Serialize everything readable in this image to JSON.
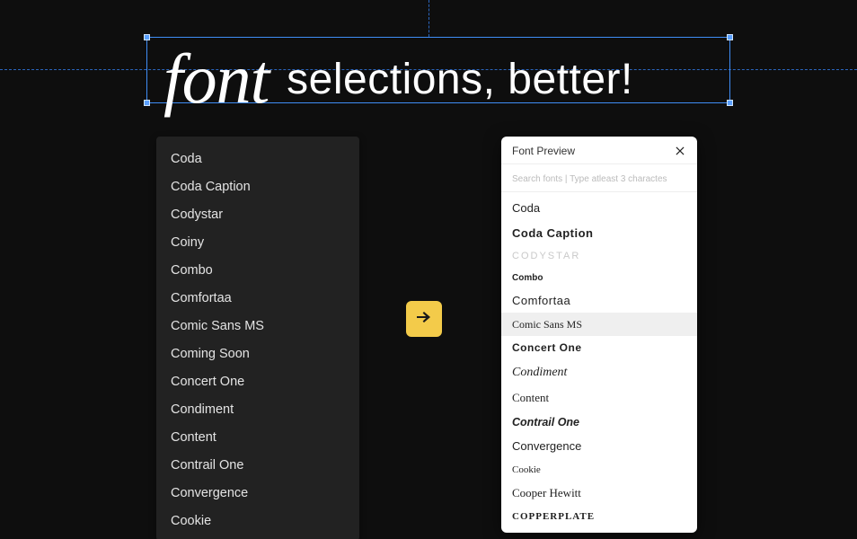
{
  "heading": {
    "script_word": "font",
    "rest": " selections, better!"
  },
  "dark_list": {
    "items": [
      "Coda",
      "Coda Caption",
      "Codystar",
      "Coiny",
      "Combo",
      "Comfortaa",
      "Comic Sans MS",
      "Coming Soon",
      "Concert One",
      "Condiment",
      "Content",
      "Contrail One",
      "Convergence",
      "Cookie"
    ]
  },
  "font_panel": {
    "title": "Font Preview",
    "search_placeholder": "Search fonts | Type atleast 3 charactes",
    "items": [
      {
        "label": "Coda",
        "style": ""
      },
      {
        "label": "Coda Caption",
        "style": "st-bold"
      },
      {
        "label": "CODYSTAR",
        "style": "st-light"
      },
      {
        "label": "Combo",
        "style": "st-tiny"
      },
      {
        "label": "Comfortaa",
        "style": "st-round"
      },
      {
        "label": "Comic Sans MS",
        "style": "st-comic",
        "selected": true
      },
      {
        "label": "Concert One",
        "style": "st-block"
      },
      {
        "label": "Condiment",
        "style": "st-script"
      },
      {
        "label": "Content",
        "style": "st-serif"
      },
      {
        "label": "Contrail One",
        "style": "st-bolditalic"
      },
      {
        "label": "Convergence",
        "style": ""
      },
      {
        "label": "Cookie",
        "style": "st-cookie"
      },
      {
        "label": "Cooper Hewitt",
        "style": "st-serif"
      },
      {
        "label": "Copperplate",
        "style": "st-copper"
      }
    ]
  },
  "icons": {
    "arrow": "arrow-right-icon",
    "close": "close-icon"
  }
}
